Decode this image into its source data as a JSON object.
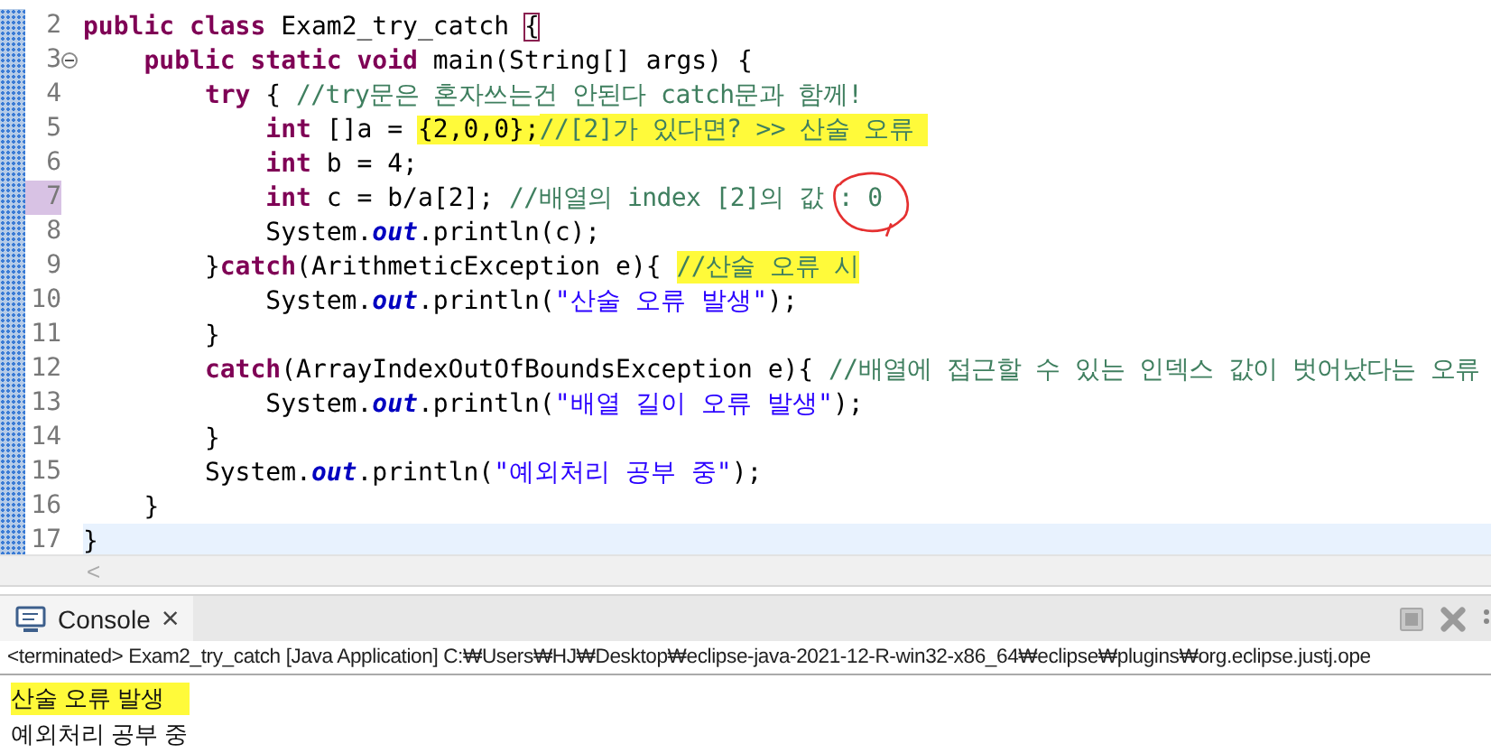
{
  "editor": {
    "lines": [
      {
        "number": "2",
        "marked": false,
        "current": false,
        "folding": false,
        "tokens": [
          {
            "kind": "keyword",
            "text": "public"
          },
          {
            "kind": "keyword",
            "text": " class"
          },
          {
            "kind": "plain",
            "text": " Exam2_try_catch "
          },
          {
            "kind": "matched_bracket",
            "text": "{"
          }
        ]
      },
      {
        "number": "3",
        "marked": false,
        "current": false,
        "folding": true,
        "tokens": [
          {
            "kind": "keyword",
            "text": "    public static void"
          },
          {
            "kind": "plain",
            "text": " main(String[] args) {"
          }
        ]
      },
      {
        "number": "4",
        "marked": false,
        "current": false,
        "folding": false,
        "tokens": [
          {
            "kind": "keyword",
            "text": "        try"
          },
          {
            "kind": "plain",
            "text": " { "
          },
          {
            "kind": "comment",
            "text": "//try문은 혼자쓰는건 안된다 catch문과 함께!"
          }
        ]
      },
      {
        "number": "5",
        "marked": false,
        "current": false,
        "folding": false,
        "tokens": [
          {
            "kind": "keyword",
            "text": "            int"
          },
          {
            "kind": "plain",
            "text": " []a ="
          },
          {
            "kind": "highlighted_plain",
            "text": " {2,0,0};"
          },
          {
            "kind": "highlighted_comment",
            "text": "//[2]가 있다면? >> 산술 오류 "
          }
        ]
      },
      {
        "number": "6",
        "marked": false,
        "current": false,
        "folding": false,
        "tokens": [
          {
            "kind": "keyword",
            "text": "            int"
          },
          {
            "kind": "plain",
            "text": " b = 4;"
          }
        ]
      },
      {
        "number": "7",
        "marked": true,
        "current": false,
        "folding": false,
        "tokens": [
          {
            "kind": "keyword",
            "text": "            int"
          },
          {
            "kind": "plain",
            "text": " c = b/a[2]; "
          },
          {
            "kind": "comment",
            "text": "//배열의 index [2]의 값 "
          },
          {
            "kind": "circled_comment",
            "text": ": 0"
          }
        ]
      },
      {
        "number": "8",
        "marked": false,
        "current": false,
        "folding": false,
        "tokens": [
          {
            "kind": "plain",
            "text": "            System."
          },
          {
            "kind": "field",
            "text": "out"
          },
          {
            "kind": "plain",
            "text": ".println(c);"
          }
        ]
      },
      {
        "number": "9",
        "marked": false,
        "current": false,
        "folding": false,
        "tokens": [
          {
            "kind": "plain",
            "text": "        }"
          },
          {
            "kind": "keyword",
            "text": "catch"
          },
          {
            "kind": "plain",
            "text": "(ArithmeticException e){"
          },
          {
            "kind": "highlighted_comment",
            "text": " //산술 오류 시"
          }
        ]
      },
      {
        "number": "10",
        "marked": false,
        "current": false,
        "folding": false,
        "tokens": [
          {
            "kind": "plain",
            "text": "            System."
          },
          {
            "kind": "field",
            "text": "out"
          },
          {
            "kind": "plain",
            "text": ".println("
          },
          {
            "kind": "string",
            "text": "\"산술 오류 발생\""
          },
          {
            "kind": "plain",
            "text": ");"
          }
        ]
      },
      {
        "number": "11",
        "marked": false,
        "current": false,
        "folding": false,
        "tokens": [
          {
            "kind": "plain",
            "text": "        }"
          }
        ]
      },
      {
        "number": "12",
        "marked": false,
        "current": false,
        "folding": false,
        "tokens": [
          {
            "kind": "keyword",
            "text": "        catch"
          },
          {
            "kind": "plain",
            "text": "(ArrayIndexOutOfBoundsException e){ "
          },
          {
            "kind": "comment",
            "text": "//배열에 접근할 수 있는 인덱스 값이 벗어났다는 오류"
          }
        ]
      },
      {
        "number": "13",
        "marked": false,
        "current": false,
        "folding": false,
        "tokens": [
          {
            "kind": "plain",
            "text": "            System."
          },
          {
            "kind": "field",
            "text": "out"
          },
          {
            "kind": "plain",
            "text": ".println("
          },
          {
            "kind": "string",
            "text": "\"배열 길이 오류 발생\""
          },
          {
            "kind": "plain",
            "text": ");"
          }
        ]
      },
      {
        "number": "14",
        "marked": false,
        "current": false,
        "folding": false,
        "tokens": [
          {
            "kind": "plain",
            "text": "        }"
          }
        ]
      },
      {
        "number": "15",
        "marked": false,
        "current": false,
        "folding": false,
        "tokens": [
          {
            "kind": "plain",
            "text": "        System."
          },
          {
            "kind": "field",
            "text": "out"
          },
          {
            "kind": "plain",
            "text": ".println("
          },
          {
            "kind": "string",
            "text": "\"예외처리 공부 중\""
          },
          {
            "kind": "plain",
            "text": ");"
          }
        ]
      },
      {
        "number": "16",
        "marked": false,
        "current": false,
        "folding": false,
        "tokens": [
          {
            "kind": "plain",
            "text": "    }"
          }
        ]
      },
      {
        "number": "17",
        "marked": false,
        "current": true,
        "folding": false,
        "tokens": [
          {
            "kind": "plain",
            "text": "}"
          }
        ]
      }
    ],
    "scroll_left": "<"
  },
  "console": {
    "tab": {
      "label": "Console",
      "close": "×"
    },
    "status": "<terminated> Exam2_try_catch [Java Application] C:₩Users₩HJ₩Desktop₩eclipse-java-2021-12-R-win32-x86_64₩eclipse₩plugins₩org.eclipse.justj.ope",
    "output": [
      {
        "text": "산술 오류 발생",
        "highlighted": true
      },
      {
        "text": "예외처리 공부 중",
        "highlighted": false
      }
    ]
  }
}
